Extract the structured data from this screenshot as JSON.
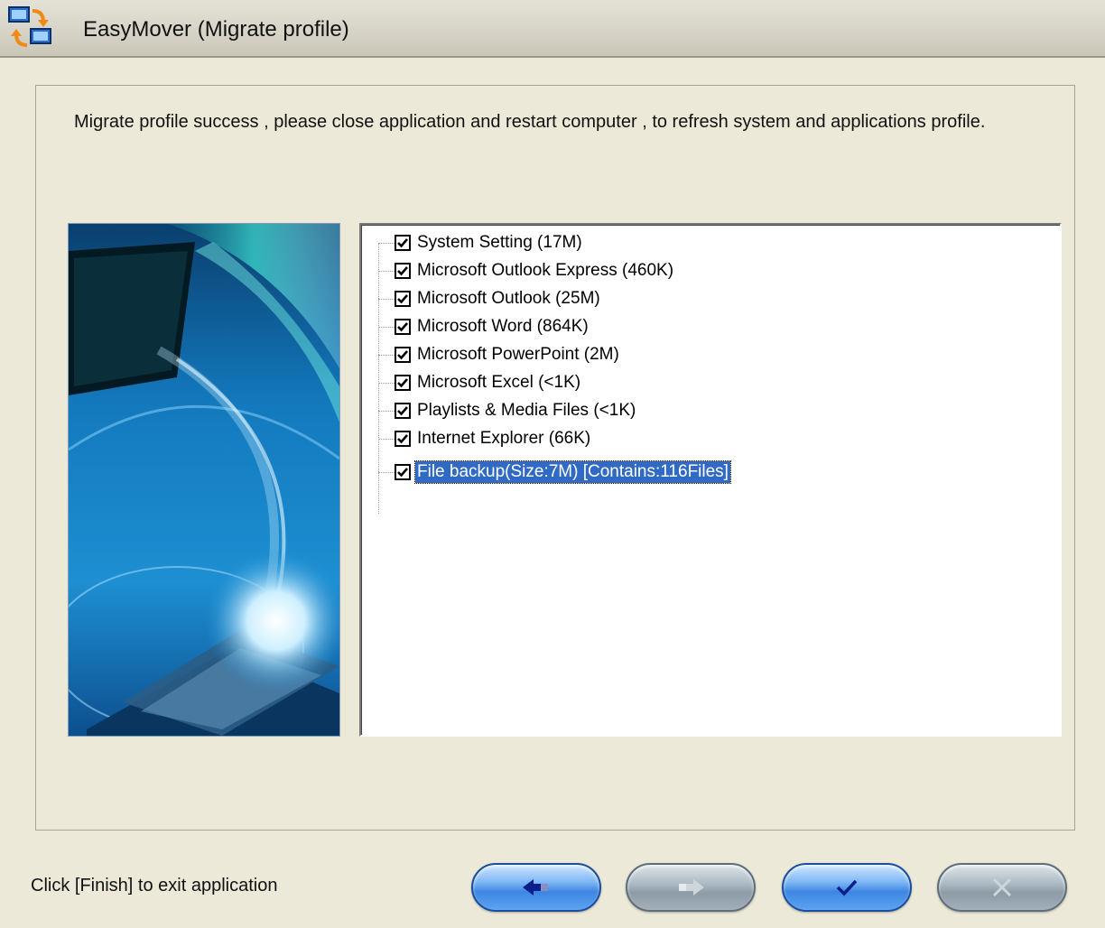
{
  "window": {
    "title": "EasyMover  (Migrate profile)"
  },
  "message": "Migrate profile success , please close application and restart computer , to refresh system and applications profile.",
  "profile_items": [
    {
      "label": "System Setting (17M)",
      "checked": true
    },
    {
      "label": "Microsoft Outlook Express (460K)",
      "checked": true
    },
    {
      "label": "Microsoft Outlook (25M)",
      "checked": true
    },
    {
      "label": "Microsoft Word (864K)",
      "checked": true
    },
    {
      "label": "Microsoft PowerPoint (2M)",
      "checked": true
    },
    {
      "label": "Microsoft Excel (<1K)",
      "checked": true
    },
    {
      "label": "Playlists & Media Files (<1K)",
      "checked": true
    },
    {
      "label": "Internet Explorer (66K)",
      "checked": true
    },
    {
      "label": "File backup(Size:7M) [Contains:116Files]",
      "checked": true,
      "selected": true
    }
  ],
  "status_text": "Click [Finish] to exit application",
  "buttons": {
    "back": {
      "icon": "arrow-left-icon",
      "enabled": true
    },
    "next": {
      "icon": "arrow-right-icon",
      "enabled": false
    },
    "finish": {
      "icon": "checkmark-icon",
      "enabled": true
    },
    "cancel": {
      "icon": "x-icon",
      "enabled": false
    }
  },
  "colors": {
    "window_bg": "#ECE9D8",
    "selection": "#316AC5",
    "button_blue": "#3d86e2",
    "button_disabled": "#8d9ba6"
  }
}
